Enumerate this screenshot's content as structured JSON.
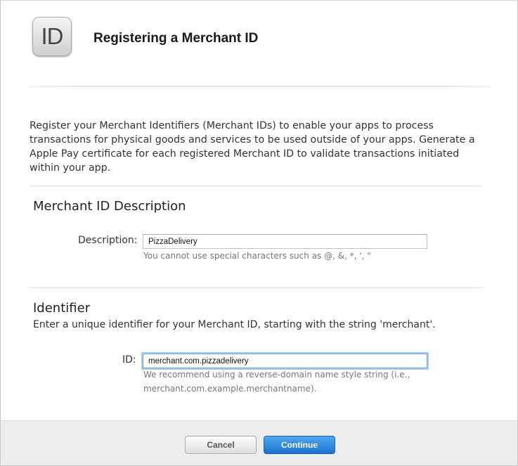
{
  "header": {
    "icon_text": "ID",
    "title": "Registering a Merchant ID"
  },
  "intro": {
    "text": "Register your Merchant Identifiers (Merchant IDs) to enable your apps to process transactions for physical goods and services to be used outside of your apps. Generate a Apple Pay certificate for each registered Merchant ID to validate transactions initiated within your app."
  },
  "description_section": {
    "title": "Merchant ID Description",
    "label": "Description:",
    "value": "PizzaDelivery",
    "hint": "You cannot use special characters such as @, &, *, ', \""
  },
  "identifier_section": {
    "title": "Identifier",
    "subtitle": "Enter a unique identifier for your Merchant ID, starting with the string 'merchant'.",
    "label": "ID:",
    "value": "merchant.com.pizzadelivery",
    "hint_line1": "We recommend using a reverse-domain name style string (i.e.,",
    "hint_line2": "merchant.com.example.merchantname)."
  },
  "footer": {
    "cancel_label": "Cancel",
    "continue_label": "Continue"
  },
  "colors": {
    "primary_button": "#1a73cf",
    "focus_ring": "#a9ccf3",
    "footer_bg": "#ededed"
  }
}
